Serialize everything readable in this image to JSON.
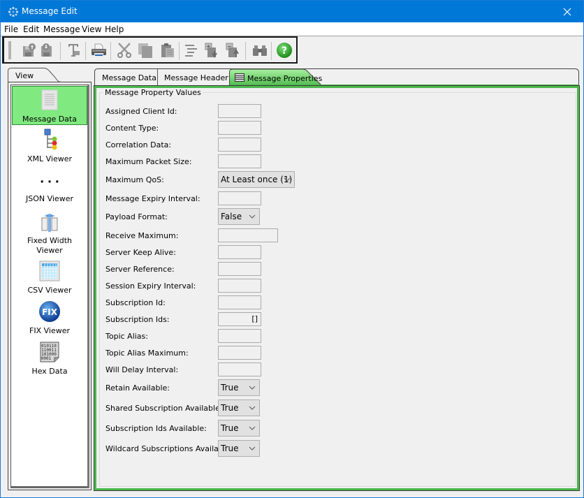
{
  "window": {
    "title": "Message Edit",
    "close_icon": "close-icon"
  },
  "menu": [
    "File",
    "Edit",
    "Message",
    "View",
    "Help"
  ],
  "toolbar": {
    "buttons": [
      {
        "name": "save-upload",
        "icon": "save-up-icon",
        "enabled": false
      },
      {
        "name": "save-download",
        "icon": "save-down-icon",
        "enabled": false
      },
      {
        "name": "format-text",
        "icon": "text-format-icon",
        "enabled": false
      },
      {
        "name": "print",
        "icon": "printer-icon",
        "enabled": true
      },
      {
        "name": "cut",
        "icon": "scissors-icon",
        "enabled": false
      },
      {
        "name": "copy",
        "icon": "copy-icon",
        "enabled": false
      },
      {
        "name": "paste",
        "icon": "clipboard-icon",
        "enabled": false
      },
      {
        "name": "align",
        "icon": "align-icon",
        "enabled": false
      },
      {
        "name": "add-property",
        "icon": "add-down-icon",
        "enabled": false
      },
      {
        "name": "remove-property",
        "icon": "remove-up-icon",
        "enabled": false
      },
      {
        "name": "find",
        "icon": "binoculars-icon",
        "enabled": false
      },
      {
        "name": "help",
        "icon": "help-icon",
        "enabled": true
      }
    ]
  },
  "view_panel": {
    "tab_label": "View",
    "items": [
      {
        "label": "Message Data",
        "icon": "document-icon",
        "selected": true
      },
      {
        "label": "XML Viewer",
        "icon": "xml-tree-icon",
        "selected": false
      },
      {
        "label": "JSON Viewer",
        "icon": "json-braces-icon",
        "selected": false
      },
      {
        "label": "Fixed Width\nViewer",
        "label_line1": "Fixed Width",
        "label_line2": "Viewer",
        "icon": "fixed-width-icon",
        "selected": false
      },
      {
        "label": "CSV Viewer",
        "icon": "csv-grid-icon",
        "selected": false
      },
      {
        "label": "FIX Viewer",
        "icon": "fix-globe-icon",
        "selected": false
      },
      {
        "label": "Hex Data",
        "icon": "hex-data-icon",
        "selected": false
      }
    ]
  },
  "tabs": [
    {
      "label": "Message Data",
      "active": false
    },
    {
      "label": "Message Header",
      "active": false
    },
    {
      "label": "Message Properties",
      "active": true,
      "icon": "list-icon"
    }
  ],
  "properties": {
    "group_title": "Message Property Values",
    "fields": [
      {
        "label": "Assigned Client Id:",
        "type": "text",
        "value": ""
      },
      {
        "label": "Content Type:",
        "type": "text",
        "value": ""
      },
      {
        "label": "Correlation Data:",
        "type": "text",
        "value": ""
      },
      {
        "label": "Maximum Packet Size:",
        "type": "text",
        "value": ""
      },
      {
        "label": "Maximum QoS:",
        "type": "combo",
        "value": "At Least once (1)"
      },
      {
        "label": "Message Expiry Interval:",
        "type": "text",
        "value": ""
      },
      {
        "label": "Payload Format:",
        "type": "combo",
        "value": "False"
      },
      {
        "label": "Receive Maximum:",
        "type": "text",
        "value": ""
      },
      {
        "label": "Server Keep Alive:",
        "type": "text",
        "value": ""
      },
      {
        "label": "Server Reference:",
        "type": "text",
        "value": ""
      },
      {
        "label": "Session Expiry Interval:",
        "type": "text",
        "value": ""
      },
      {
        "label": "Subscription Id:",
        "type": "text",
        "value": ""
      },
      {
        "label": "Subscription Ids:",
        "type": "text",
        "value": "[]"
      },
      {
        "label": "Topic Alias:",
        "type": "text",
        "value": ""
      },
      {
        "label": "Topic Alias Maximum:",
        "type": "text",
        "value": ""
      },
      {
        "label": "Will Delay Interval:",
        "type": "text",
        "value": ""
      },
      {
        "label": "Retain Available:",
        "type": "combo",
        "value": "True"
      },
      {
        "label": "Shared Subscription Available:",
        "type": "combo",
        "value": "True"
      },
      {
        "label": "Subscription Ids Available:",
        "type": "combo",
        "value": "True"
      },
      {
        "label": "Wildcard Subscriptions Available:",
        "type": "combo",
        "value": "True"
      }
    ]
  },
  "colors": {
    "titlebar": "#0078d7",
    "selected_green": "#80e980",
    "tab_green": "#4cb84c"
  }
}
